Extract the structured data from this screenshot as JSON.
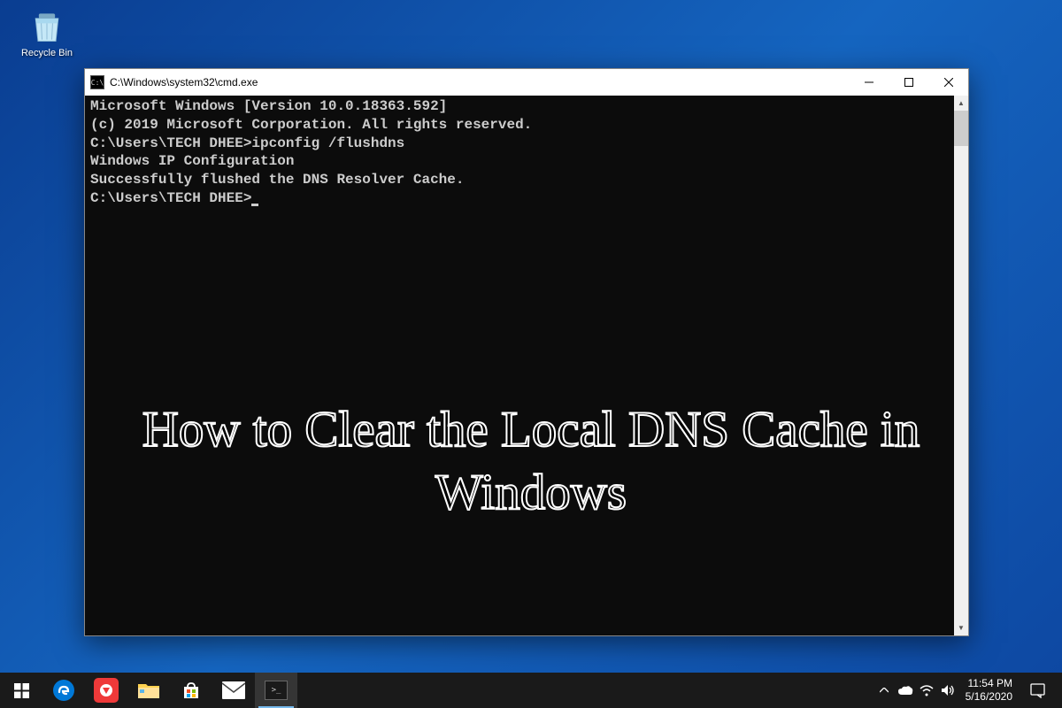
{
  "desktop": {
    "recycle_bin_label": "Recycle Bin"
  },
  "cmd_window": {
    "title": "C:\\Windows\\system32\\cmd.exe",
    "icon_glyph": "C:\\",
    "lines": [
      "Microsoft Windows [Version 10.0.18363.592]",
      "(c) 2019 Microsoft Corporation. All rights reserved.",
      "",
      "C:\\Users\\TECH DHEE>ipconfig /flushdns",
      "",
      "Windows IP Configuration",
      "",
      "Successfully flushed the DNS Resolver Cache.",
      "",
      "C:\\Users\\TECH DHEE>"
    ]
  },
  "overlay": {
    "text": "How to Clear the Local DNS Cache in Windows"
  },
  "taskbar": {
    "time": "11:54 PM",
    "date": "5/16/2020",
    "tray_icons": [
      "chevron-up",
      "onedrive",
      "wifi",
      "volume"
    ]
  }
}
